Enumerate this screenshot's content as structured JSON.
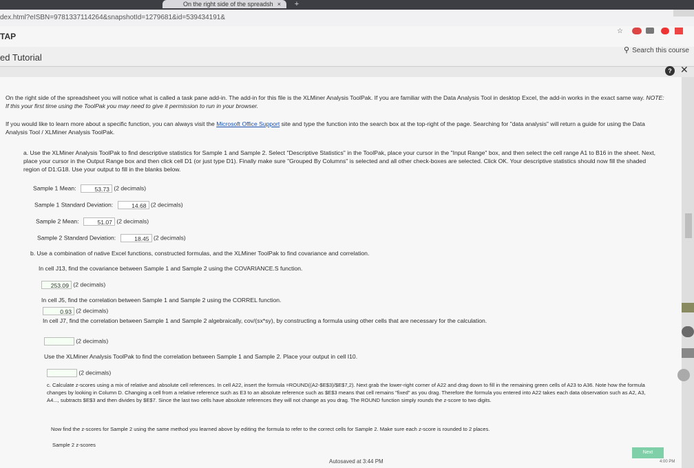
{
  "browser": {
    "tab_title": "On the right side of the spreadsh",
    "tab_close": "×",
    "new_tab": "+",
    "url": "dex.html?eISBN=9781337114264&snapshotId=1279681&id=539434191&",
    "bookmark_icon": "☆"
  },
  "header": {
    "app_name": "TAP",
    "search_label": "Search this course",
    "section_title": "ed Tutorial"
  },
  "content": {
    "intro1": "On the right side of the spreadsheet you will notice what is called a task pane add-in. The add-in for this file is the XLMiner Analysis ToolPak. If you are familiar with the Data Analysis Tool in desktop Excel, the add-in works in the exact same way.",
    "intro1_note": "NOTE: If this your first time using the ToolPak you may need to give it permission to run in your browser.",
    "intro2_a": "If you would like to learn more about a specific function, you can always visit the",
    "intro2_link": "Microsoft Office Support",
    "intro2_b": "site and type the function into the search box at the top-right of the page. Searching for \"data analysis\" will return a guide for using the Data Analysis Tool / XLMiner Analysis ToolPak.",
    "part_a": "a. Use the XLMiner Analysis ToolPak to find descriptive statistics for Sample 1 and Sample 2. Select \"Descriptive Statistics\" in the ToolPak, place your cursor in the \"Input Range\" box, and then select the cell range A1 to B16 in the sheet. Next, place your cursor in the Output Range box and then click cell D1 (or just type D1). Finally make sure \"Grouped By Columns\" is selected and all other check-boxes are selected. Click OK. Your descriptive statistics should now fill the shaded region of D1:G18. Use your output to fill in the blanks below.",
    "s1_mean_label": "Sample 1 Mean:",
    "s1_mean": "53.73",
    "s1_sd_label": "Sample 1 Standard Deviation:",
    "s1_sd": "14.68",
    "s2_mean_label": "Sample 2 Mean:",
    "s2_mean": "51.07",
    "s2_sd_label": "Sample 2 Standard Deviation:",
    "s2_sd": "18.45",
    "decimals": "(2 decimals)",
    "part_b": "b. Use a combination of native Excel functions, constructed formulas, and the XLMiner ToolPak to find covariance and correlation.",
    "j13_text": "In cell J13, find the covariance between Sample 1 and Sample 2 using the COVARIANCE.S function.",
    "j13_value": "253.09",
    "j15_text": "In cell J5, find the correlation between Sample 1 and Sample 2 using the CORREL function.",
    "j15_value": "0.93",
    "j17_text": "In cell J7, find the correlation between Sample 1 and Sample 2 algebraically, cov/(sx*sy), by constructing a formula using other cells that are necessary for the calculation.",
    "j17_value": "",
    "toolpak_text": "Use the XLMiner Analysis ToolPak to find the correlation between Sample 1 and Sample 2. Place your output in cell I10.",
    "toolpak_value": "",
    "part_c": "c. Calculate z-scores using a mix of relative and absolute cell references. In cell A22, insert the formula =ROUND((A2-$E$3)/$E$7,2). Next grab the lower-right corner of A22 and drag down to fill in the remaining green cells of A23 to A36. Note how the formula changes by looking in Column D. Changing a cell from a relative reference such as E3 to an absolute reference such as $E$3 means that cell remains \"fixed\" as you drag. Therefore the formula you entered into A22 takes each data observation such as A2, A3, A4..., subtracts $E$3 and then divides by $E$7. Since the last two cells have absolute references they will not change as you drag. The ROUND function simply rounds the z-score to two digits.",
    "part_c2": "Now find the z-scores for Sample 2 using the same method you learned above by editing the formula to refer to the correct cells for Sample 2. Make sure each z-score is rounded to 2 places.",
    "s2_z_label": "Sample 2 z-scores"
  },
  "footer": {
    "next": "Next",
    "autosave": "Autosaved at 3:44 PM",
    "clock": "4:00 PM"
  }
}
